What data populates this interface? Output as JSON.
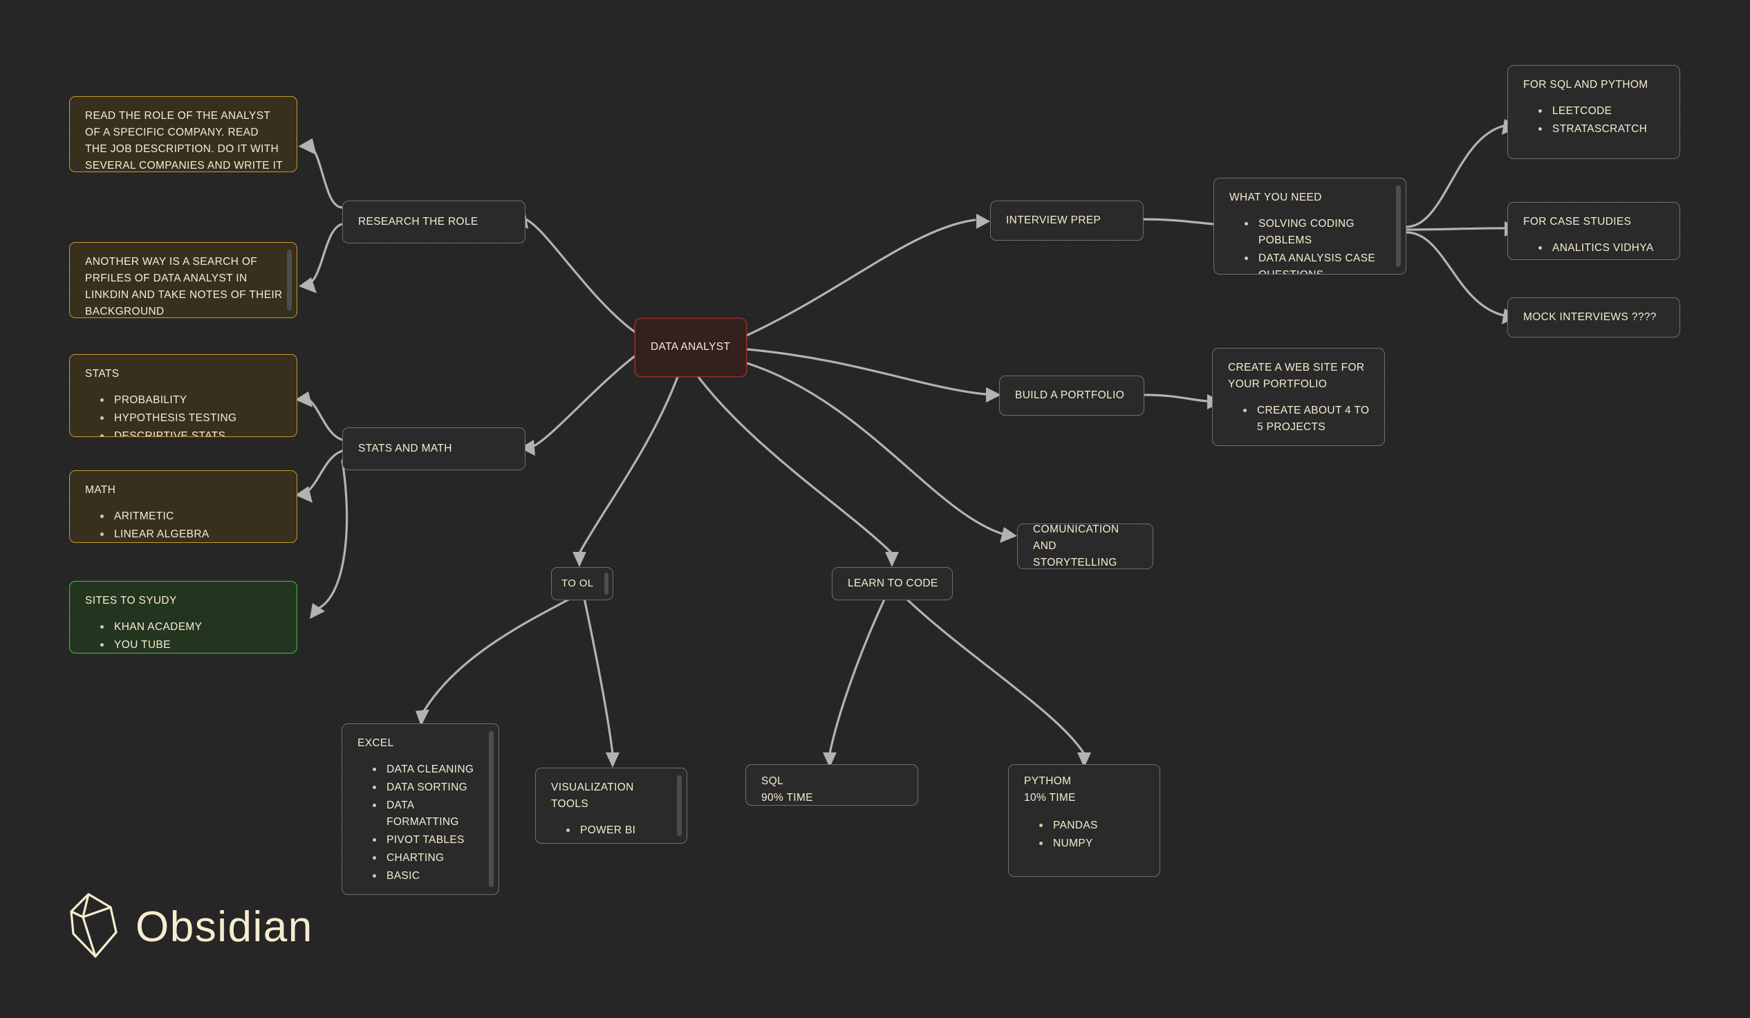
{
  "app": {
    "name": "Obsidian",
    "logo_icon": "obsidian-crystal-icon",
    "canvas_background": "#262626",
    "accent_colors": {
      "red": "#9c2b2b",
      "yellow": "#c89b29",
      "green": "#3cc53c",
      "default_border": "#6f6f6f",
      "text": "#f7ecd2",
      "edge": "#b3b3b3"
    }
  },
  "nodes": {
    "read_role": {
      "title": "READ THE ROLE OF THE ANALYST OF A SPECIFIC COMPANY. READ THE JOB DESCRIPTION. DO IT WITH SEVERAL COMPANIES AND WRITE IT DOWN",
      "color": "yellow"
    },
    "another_way": {
      "title": "ANOTHER WAY IS A SEARCH OF PRFILES OF DATA ANALYST IN LINKDIN AND TAKE NOTES OF THEIR BACKGROUND",
      "color": "yellow"
    },
    "research_role": {
      "title": "RESEARCH THE ROLE",
      "color": "default"
    },
    "stats": {
      "title": "STATS",
      "color": "yellow",
      "items": [
        "PROBABILITY",
        "HYPOTHESIS TESTING",
        "DESCRIPTIVE STATS"
      ]
    },
    "math": {
      "title": "MATH",
      "color": "yellow",
      "items": [
        "ARITMETIC",
        "LINEAR ALGEBRA"
      ]
    },
    "sites_to_study": {
      "title": "SITES TO SYUDY",
      "color": "green",
      "items": [
        "KHAN ACADEMY",
        "YOU TUBE"
      ]
    },
    "stats_and_math": {
      "title": "STATS AND MATH",
      "color": "default"
    },
    "data_analyst": {
      "title": "DATA ANALYST",
      "color": "red"
    },
    "interview_prep": {
      "title": "INTERVIEW PREP",
      "color": "default"
    },
    "what_you_need": {
      "title": "WHAT YOU NEED",
      "color": "default",
      "items": [
        "SOLVING CODING POBLEMS",
        "DATA ANALYSIS CASE QUESTIONS"
      ]
    },
    "for_sql_and_python": {
      "title": "FOR SQL AND PYTHOM",
      "color": "default",
      "items": [
        "LEETCODE",
        "STRATASCRATCH"
      ]
    },
    "for_case_studies": {
      "title": "FOR CASE STUDIES",
      "color": "default",
      "items": [
        "ANALITICS VIDHYA"
      ]
    },
    "mock_interviews": {
      "title": "MOCK INTERVIEWS ????",
      "color": "default"
    },
    "build_portfolio": {
      "title": "BUILD A PORTFOLIO",
      "color": "default"
    },
    "create_website": {
      "title": "CREATE A WEB SITE FOR YOUR PORTFOLIO",
      "color": "default",
      "items": [
        "CREATE ABOUT 4 TO 5 PROJECTS"
      ]
    },
    "communication": {
      "title": "COMUNICATION AND STORYTELLING",
      "color": "default"
    },
    "tool": {
      "title": "TO OL",
      "color": "default"
    },
    "learn_to_code": {
      "title": "LEARN TO CODE",
      "color": "default"
    },
    "excel": {
      "title": "EXCEL",
      "color": "default",
      "items": [
        "DATA CLEANING",
        "DATA SORTING",
        "DATA FORMATTING",
        "PIVOT TABLES",
        "CHARTING",
        "BASIC"
      ]
    },
    "visualization_tools": {
      "title": "VISUALIZATION TOOLS",
      "color": "default",
      "items": [
        "POWER BI"
      ]
    },
    "sql": {
      "title": "SQL\n90% TIME",
      "color": "default"
    },
    "python": {
      "title": "PYTHOM\n10% TIME",
      "color": "default",
      "items": [
        "PANDAS",
        "NUMPY"
      ]
    }
  }
}
